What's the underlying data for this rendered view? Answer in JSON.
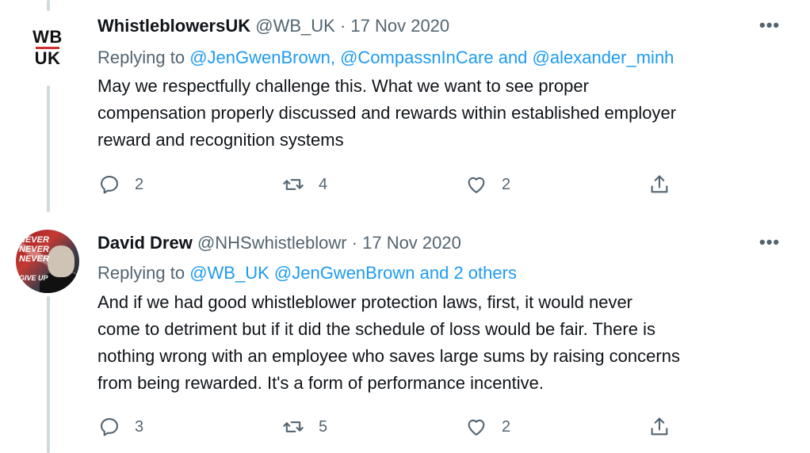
{
  "tweets": [
    {
      "avatar": {
        "line1": "WB",
        "line2": "UK"
      },
      "name": "WhistleblowersUK",
      "meta": "@WB_UK · 17 Nov 2020",
      "more": "•••",
      "replying_prefix": "Replying to ",
      "replying_parts": [
        "@JenGwenBrown",
        ", ",
        "@CompassnInCare",
        " and ",
        "@alexander_minh"
      ],
      "body": [
        "May we respectfully challenge this. What we want to see proper",
        "compensation properly discussed and rewards within established employer",
        "reward and recognition systems"
      ],
      "actions": {
        "replies": "2",
        "retweets": "4",
        "likes": "2"
      }
    },
    {
      "avatar": {
        "text": [
          "NEVER",
          "NEVER",
          "NEVER",
          "GIVE UP"
        ]
      },
      "name": "David Drew",
      "meta": "@NHSwhistleblowr · 17 Nov 2020",
      "more": "•••",
      "replying_prefix": "Replying to ",
      "replying_parts": [
        "@WB_UK",
        " ",
        "@JenGwenBrown",
        "  and 2 others"
      ],
      "body": [
        "And if we had good whistleblower protection laws, first, it would never",
        "come to detriment but if it did the schedule of loss would be fair. There is",
        "nothing wrong with an employee who saves large sums by raising concerns",
        "from being rewarded. It's a form of performance incentive."
      ],
      "actions": {
        "replies": "3",
        "retweets": "5",
        "likes": "2"
      }
    }
  ],
  "colors": {
    "accent": "#1d9bf0",
    "muted": "#536471",
    "text": "#0f1419",
    "thread": "#cfd9de"
  }
}
